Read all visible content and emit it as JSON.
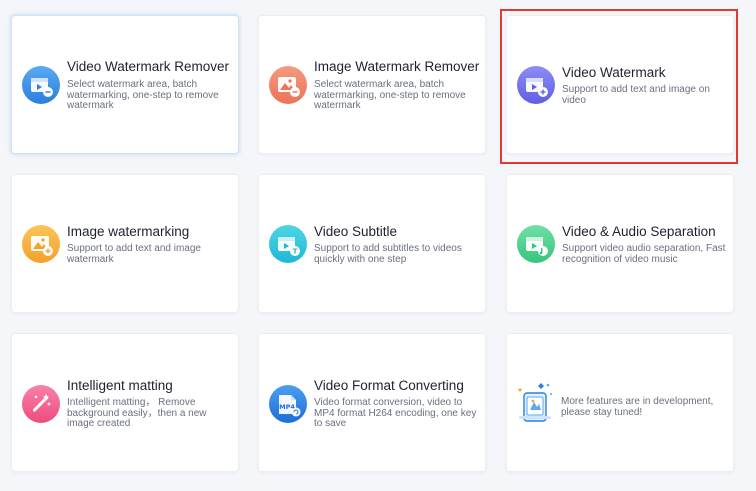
{
  "cards": [
    {
      "title": "Video Watermark Remover",
      "desc": "Select watermark area, batch watermarking, one-step to remove watermark",
      "icon": "video-clapper-icon",
      "color_top": "#5aa9f2",
      "color_bottom": "#2a7fe0"
    },
    {
      "title": "Image Watermark Remover",
      "desc": "Select watermark area, batch watermarking, one-step to remove watermark",
      "icon": "image-remove-icon",
      "color_top": "#f59a7e",
      "color_bottom": "#ec7457"
    },
    {
      "title": "Video Watermark",
      "desc": "Support to add text and image on video",
      "icon": "video-clapper-icon",
      "color_top": "#8e8cf4",
      "color_bottom": "#5f5fe6"
    },
    {
      "title": "Image watermarking",
      "desc": "Support to add text and image watermark",
      "icon": "image-add-icon",
      "color_top": "#fcc45a",
      "color_bottom": "#f5a02a"
    },
    {
      "title": "Video Subtitle",
      "desc": "Support to add subtitles to videos quickly with one step",
      "icon": "video-subtitle-icon",
      "color_top": "#4fd6e6",
      "color_bottom": "#1db9d4"
    },
    {
      "title": "Video & Audio Separation",
      "desc": "Support video audio separation, Fast recognition of video music",
      "icon": "video-audio-icon",
      "color_top": "#6fe0a4",
      "color_bottom": "#38c47e"
    },
    {
      "title": "Intelligent matting",
      "desc": "Intelligent matting， Remove background easily，then a new image created",
      "icon": "magic-wand-icon",
      "color_top": "#f882a8",
      "color_bottom": "#ee4b7e"
    },
    {
      "title": "Video Format Converting",
      "desc": "Video format conversion, video to MP4 format H264 encoding, one key to save",
      "icon": "mp4-file-icon",
      "color_top": "#4b9ff0",
      "color_bottom": "#1e6ed8"
    }
  ],
  "more": {
    "text": "More features are in development, please stay tuned!",
    "icon": "development-illustration-icon"
  },
  "mp4_label": "MP4"
}
